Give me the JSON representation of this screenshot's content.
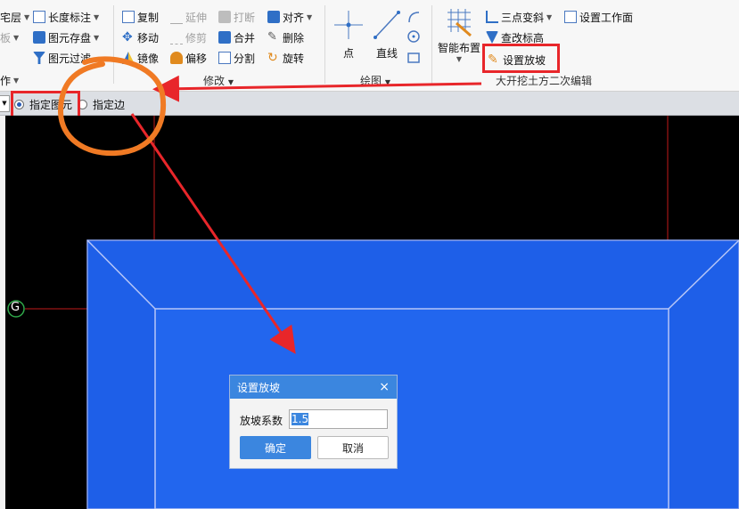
{
  "ribbon": {
    "col1": {
      "item1": "宅层",
      "item2": "板",
      "item3": "作"
    },
    "col2": {
      "item1": "长度标注",
      "item2": "图元存盘",
      "item3": "图元过滤"
    },
    "modify": {
      "copy": "复制",
      "extend": "延伸",
      "break": "打断",
      "align": "对齐",
      "move": "移动",
      "trim": "修剪",
      "merge": "合并",
      "delete": "删除",
      "mirror": "镜像",
      "offset": "偏移",
      "split": "分割",
      "rotate": "旋转",
      "group_label": "修改"
    },
    "draw": {
      "point": "点",
      "line": "直线",
      "group_label": "绘图"
    },
    "edit2": {
      "smart_layout": "智能布置",
      "three_point_slope": "三点变斜",
      "set_work_face": "设置工作面",
      "change_elevation": "查改标高",
      "set_slope": "设置放坡",
      "group_label": "大开挖土方二次编辑"
    }
  },
  "toolbar2": {
    "option_element": "指定图元",
    "option_edge": "指定边"
  },
  "canvas": {
    "axis_label": "G"
  },
  "dialog": {
    "title": "设置放坡",
    "close_glyph": "×",
    "field_label": "放坡系数",
    "field_value": "1.5",
    "ok_label": "确定",
    "cancel_label": "取消"
  },
  "colors": {
    "ribbon_bg": "#f7f7f7",
    "canvas_bg": "#000000",
    "shape_blue": "#1e5fe8",
    "accent_blue": "#3b86df",
    "annotation_red": "#e8262a",
    "annotation_orange": "#f07a24"
  }
}
